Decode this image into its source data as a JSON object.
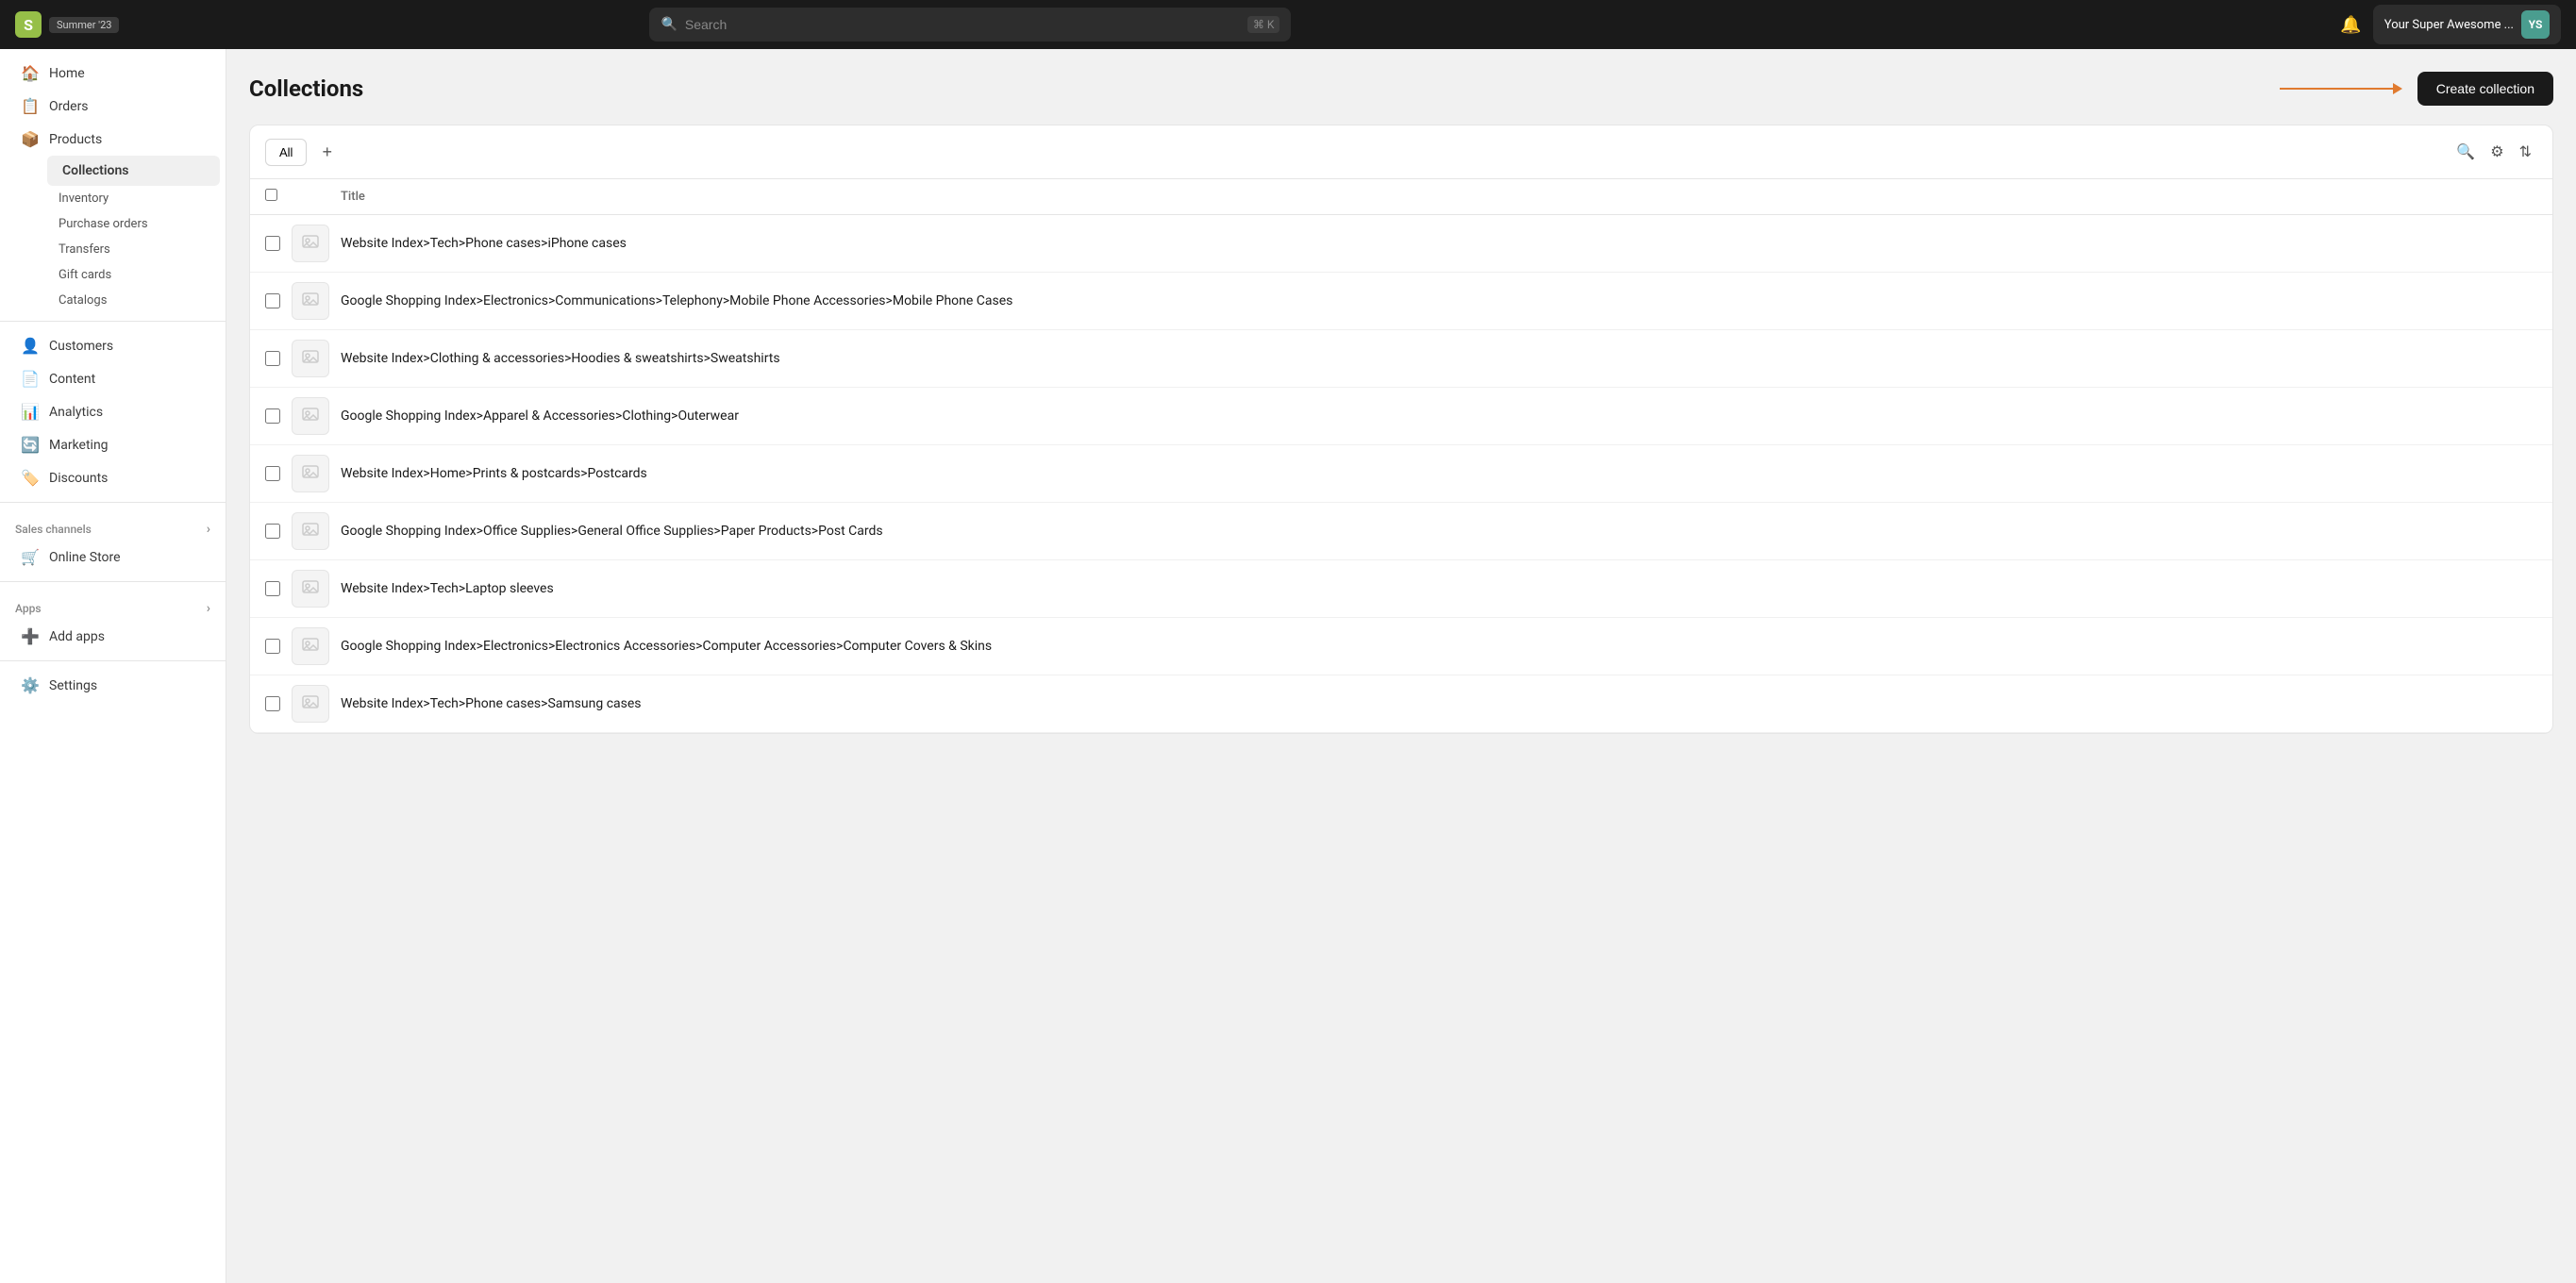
{
  "topbar": {
    "logo_letter": "S",
    "badge": "Summer '23",
    "search_placeholder": "Search",
    "shortcut": "⌘ K",
    "bell_icon": "🔔",
    "store_name": "Your Super Awesome ...",
    "avatar_initials": "YS"
  },
  "sidebar": {
    "items": [
      {
        "id": "home",
        "label": "Home",
        "icon": "🏠"
      },
      {
        "id": "orders",
        "label": "Orders",
        "icon": "📋"
      },
      {
        "id": "products",
        "label": "Products",
        "icon": "📦"
      }
    ],
    "products_sub": [
      {
        "id": "inventory",
        "label": "Inventory",
        "active": false
      },
      {
        "id": "purchase-orders",
        "label": "Purchase orders",
        "active": false
      },
      {
        "id": "transfers",
        "label": "Transfers",
        "active": false
      },
      {
        "id": "gift-cards",
        "label": "Gift cards",
        "active": false
      },
      {
        "id": "catalogs",
        "label": "Catalogs",
        "active": false
      }
    ],
    "collections_label": "Collections",
    "other_items": [
      {
        "id": "customers",
        "label": "Customers",
        "icon": "👤"
      },
      {
        "id": "content",
        "label": "Content",
        "icon": "📄"
      },
      {
        "id": "analytics",
        "label": "Analytics",
        "icon": "📊"
      },
      {
        "id": "marketing",
        "label": "Marketing",
        "icon": "🔄"
      },
      {
        "id": "discounts",
        "label": "Discounts",
        "icon": "🏷️"
      }
    ],
    "sales_channels_label": "Sales channels",
    "online_store_label": "Online Store",
    "apps_label": "Apps",
    "add_apps_label": "Add apps",
    "settings_label": "Settings"
  },
  "page": {
    "title": "Collections",
    "create_button": "Create collection",
    "tab_all": "All",
    "tab_add": "+",
    "col_title": "Title"
  },
  "collections": [
    {
      "id": 1,
      "title": "Website Index>Tech>Phone cases>iPhone cases"
    },
    {
      "id": 2,
      "title": "Google Shopping Index>Electronics>Communications>Telephony>Mobile Phone Accessories>Mobile Phone Cases"
    },
    {
      "id": 3,
      "title": "Website Index>Clothing & accessories>Hoodies & sweatshirts>Sweatshirts"
    },
    {
      "id": 4,
      "title": "Google Shopping Index>Apparel & Accessories>Clothing>Outerwear"
    },
    {
      "id": 5,
      "title": "Website Index>Home>Prints & postcards>Postcards"
    },
    {
      "id": 6,
      "title": "Google Shopping Index>Office Supplies>General Office Supplies>Paper Products>Post Cards"
    },
    {
      "id": 7,
      "title": "Website Index>Tech>Laptop sleeves"
    },
    {
      "id": 8,
      "title": "Google Shopping Index>Electronics>Electronics Accessories>Computer Accessories>Computer Covers & Skins"
    },
    {
      "id": 9,
      "title": "Website Index>Tech>Phone cases>Samsung cases"
    }
  ]
}
